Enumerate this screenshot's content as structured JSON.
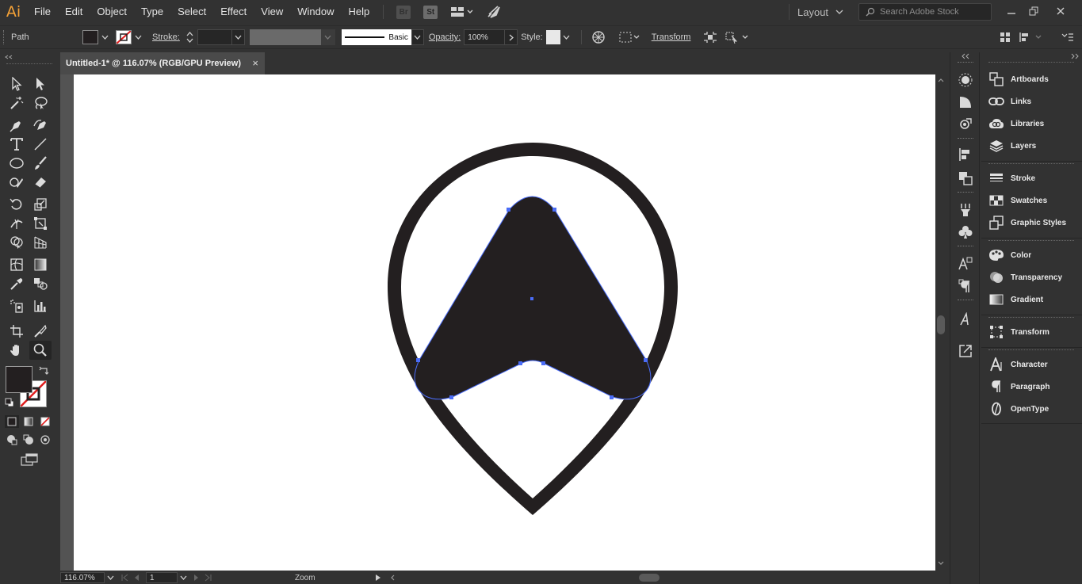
{
  "app": {
    "logo": "Ai",
    "accent": "#f5a237"
  },
  "menu": [
    "File",
    "Edit",
    "Object",
    "Type",
    "Select",
    "Effect",
    "View",
    "Window",
    "Help"
  ],
  "menubar_icons": {
    "bridge": "Br",
    "stock": "St"
  },
  "workspace": {
    "label": "Layout"
  },
  "search": {
    "placeholder": "Search Adobe Stock"
  },
  "control": {
    "selection_type": "Path",
    "stroke_label": "Stroke:",
    "brush_label": "Basic",
    "opacity_label": "Opacity:",
    "opacity_value": "100%",
    "style_label": "Style:",
    "transform_label": "Transform"
  },
  "document": {
    "tab_title": "Untitled-1* @ 116.07% (RGB/GPU Preview)",
    "close": "×"
  },
  "status": {
    "zoom": "116.07%",
    "artboard": "1",
    "tool": "Zoom"
  },
  "panels": [
    {
      "label": "Artboards",
      "icon": "artboards-icon"
    },
    {
      "label": "Links",
      "icon": "links-icon"
    },
    {
      "label": "Libraries",
      "icon": "libraries-icon"
    },
    {
      "label": "Layers",
      "icon": "layers-icon"
    },
    {
      "label": "Stroke",
      "icon": "stroke-icon"
    },
    {
      "label": "Swatches",
      "icon": "swatches-icon"
    },
    {
      "label": "Graphic Styles",
      "icon": "graphic-styles-icon"
    },
    {
      "label": "Color",
      "icon": "color-icon"
    },
    {
      "label": "Transparency",
      "icon": "transparency-icon"
    },
    {
      "label": "Gradient",
      "icon": "gradient-icon"
    },
    {
      "label": "Transform",
      "icon": "transform-icon"
    },
    {
      "label": "Character",
      "icon": "character-icon"
    },
    {
      "label": "Paragraph",
      "icon": "paragraph-icon"
    },
    {
      "label": "OpenType",
      "icon": "opentype-icon"
    }
  ],
  "colors": {
    "artwork": "#231f20",
    "selection": "#4a6cf7",
    "fill_swatch": "#231f20"
  }
}
